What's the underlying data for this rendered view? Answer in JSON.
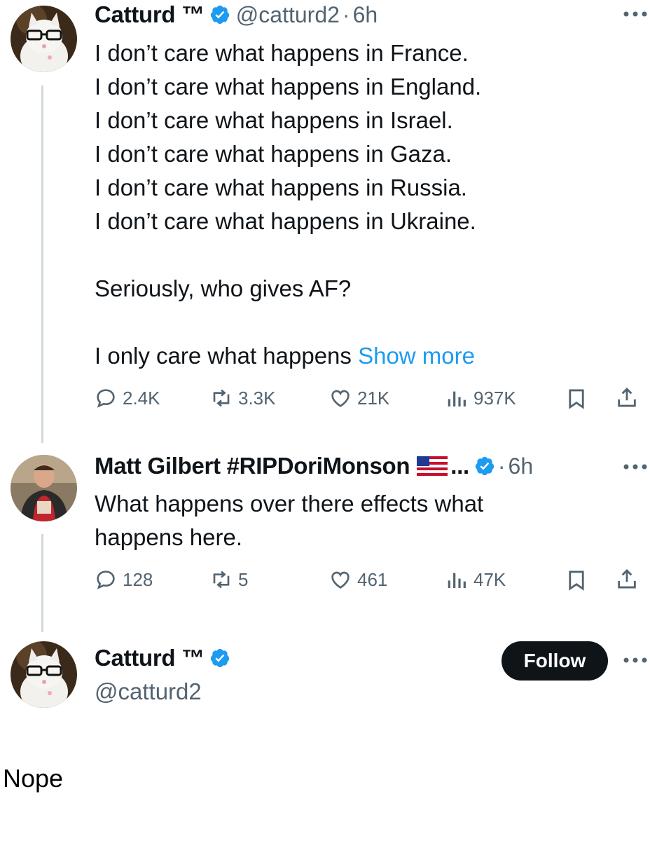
{
  "tweets": [
    {
      "display_name": "Catturd ™",
      "handle": "@catturd2",
      "separator": "·",
      "time": "6h",
      "text": "I don’t care what happens in France.\nI don’t care what happens in England.\nI don’t care what happens in Israel.\nI don’t care what happens in Gaza.\nI don’t care what happens in Russia.\nI don’t care what happens in Ukraine.\n\nSeriously, who gives AF?\n\nI only care what happens ",
      "show_more": "Show more",
      "replies": "2.4K",
      "reposts": "3.3K",
      "likes": "21K",
      "views": "937K"
    },
    {
      "display_name": "Matt Gilbert #RIPDoriMonson",
      "truncation": "...",
      "separator": "·",
      "time": "6h",
      "text": "What happens over there effects what\nhappens here.",
      "replies": "128",
      "reposts": "5",
      "likes": "461",
      "views": "47K"
    }
  ],
  "profile_card": {
    "display_name": "Catturd ™",
    "handle": "@catturd2",
    "follow_label": "Follow"
  },
  "caption": "Nope",
  "colors": {
    "link": "#1d9bf0",
    "verified": "#1d9bf0",
    "secondary_text": "#536471",
    "thread_line": "#cfd9de"
  },
  "icons": [
    "reply-icon",
    "repost-icon",
    "like-icon",
    "views-icon",
    "bookmark-icon",
    "share-icon",
    "verified-icon",
    "more-icon",
    "us-flag-icon"
  ]
}
